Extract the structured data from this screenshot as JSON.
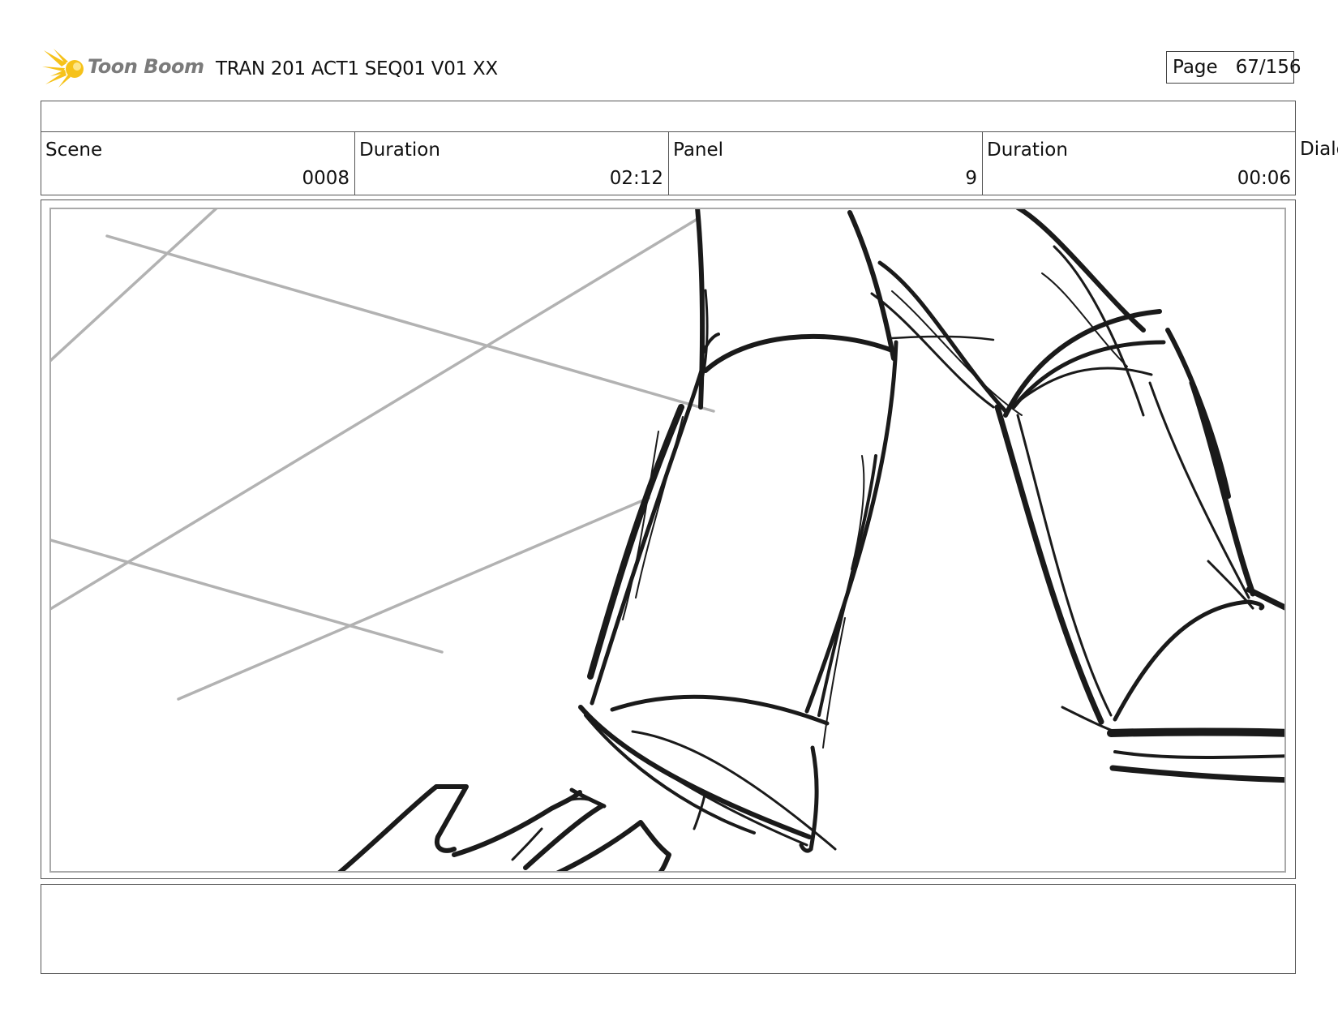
{
  "header": {
    "logo_text": "Toon Boom",
    "title": "TRAN 201 ACT1 SEQ01 V01 XX",
    "page_label": "Page",
    "page_value": "67/156"
  },
  "info": {
    "scene_label": "Scene",
    "scene_value": "0008",
    "scene_duration_label": "Duration",
    "scene_duration_value": "02:12",
    "panel_label": "Panel",
    "panel_value": "9",
    "panel_duration_label": "Duration",
    "panel_duration_value": "00:06",
    "dialog_label": "Dialo"
  },
  "colors": {
    "logo_yellow": "#f6c21a",
    "logo_text": "#7b7b7b",
    "sketch_dark": "#1a1a1a",
    "sketch_gray": "#b2b2b2"
  },
  "sketch": {
    "description_icon": "storyboard-sketch"
  }
}
